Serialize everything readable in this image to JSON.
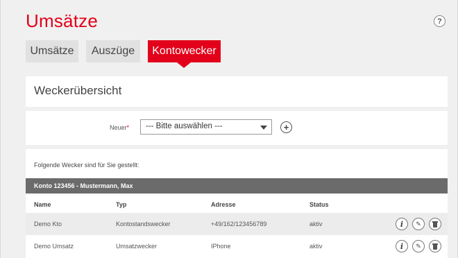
{
  "header": {
    "title": "Umsätze",
    "help_label": "?"
  },
  "tabs": [
    {
      "label": "Umsätze",
      "active": false
    },
    {
      "label": "Auszüge",
      "active": false
    },
    {
      "label": "Kontowecker",
      "active": true
    }
  ],
  "overview": {
    "title": "Weckerübersicht"
  },
  "new_form": {
    "label": "Neuer",
    "required_mark": "*",
    "select_value": "--- Bitte auswählen ---",
    "add_label": "+"
  },
  "list": {
    "intro": "Folgende Wecker sind für Sie gestellt:",
    "account": "Konto 123456 - Mustermann, Max",
    "columns": [
      "Name",
      "Typ",
      "Adresse",
      "Status"
    ],
    "rows": [
      {
        "name": "Demo Kto",
        "type": "Kontostandswecker",
        "address": "+49/162/123456789",
        "status": "aktiv"
      },
      {
        "name": "Demo Umsatz",
        "type": "Umsatzwecker",
        "address": "IPhone",
        "status": "aktiv"
      }
    ]
  },
  "icons": {
    "info": "info-icon",
    "edit": "pencil-icon",
    "delete": "trash-icon",
    "help": "question-icon",
    "add": "plus-icon"
  },
  "colors": {
    "brand_red": "#e2001a",
    "account_bar": "#6b6b6b",
    "tab_inactive": "#e1e1e1",
    "background": "#f0f0f0"
  }
}
